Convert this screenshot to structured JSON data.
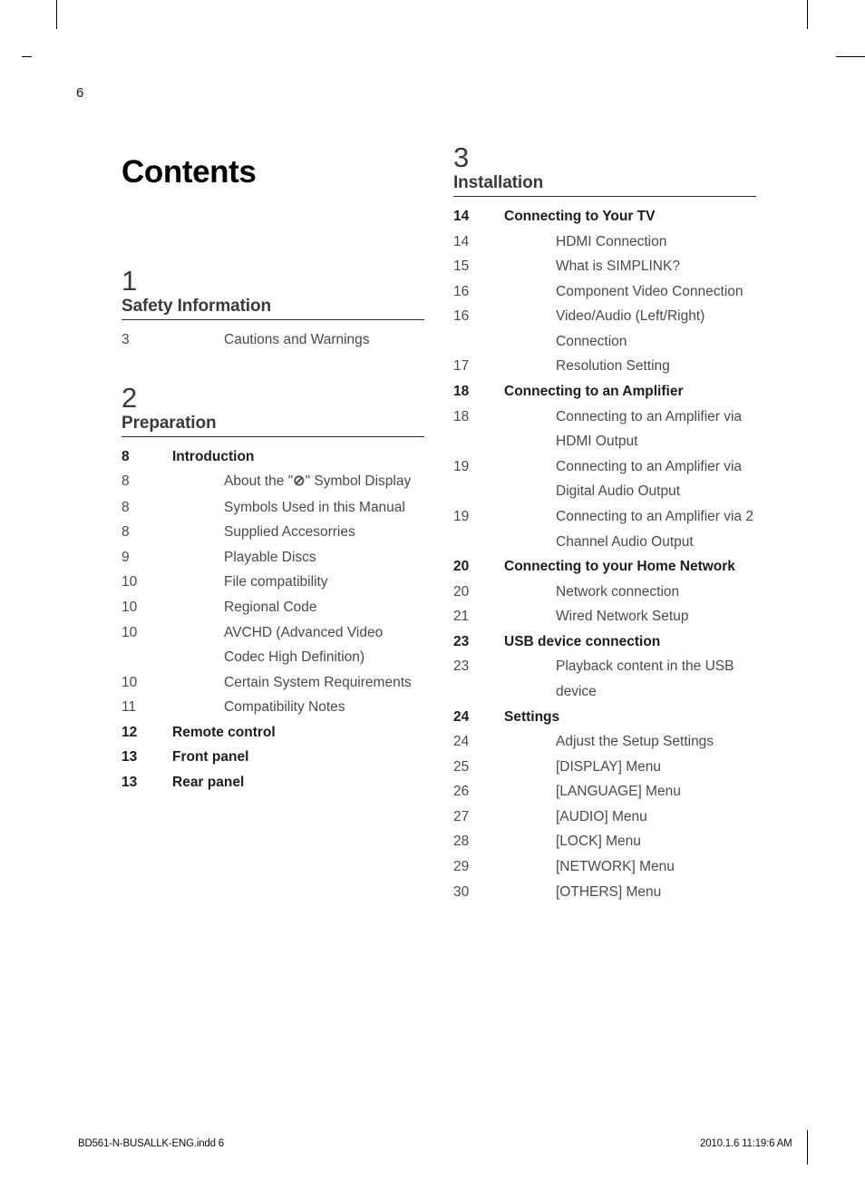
{
  "page": {
    "folio": "6",
    "title": "Contents"
  },
  "footer": {
    "filename": "BD561-N-BUSALLK-ENG.indd   6",
    "timestamp": "2010.1.6   11:19:6 AM"
  },
  "columns": {
    "left": [
      {
        "number": "1",
        "name": "Safety Information",
        "entries": [
          {
            "page": "3",
            "label": "Cautions and Warnings",
            "level": 2
          }
        ]
      },
      {
        "number": "2",
        "name": "Preparation",
        "entries": [
          {
            "page": "8",
            "label": "Introduction",
            "level": 1
          },
          {
            "page": "8",
            "label": "About the \"⊘\" Symbol Display",
            "level": 2,
            "symbol": true
          },
          {
            "page": "8",
            "label": "Symbols Used in this Manual",
            "level": 2
          },
          {
            "page": "8",
            "label": "Supplied Accesorries",
            "level": 2
          },
          {
            "page": "9",
            "label": "Playable Discs",
            "level": 2
          },
          {
            "page": "10",
            "label": "File compatibility",
            "level": 2
          },
          {
            "page": "10",
            "label": "Regional Code",
            "level": 2
          },
          {
            "page": "10",
            "label": "AVCHD (Advanced Video Codec High Definition)",
            "level": 2
          },
          {
            "page": "10",
            "label": "Certain System Requirements",
            "level": 2
          },
          {
            "page": "11",
            "label": "Compatibility Notes",
            "level": 2
          },
          {
            "page": "12",
            "label": "Remote control",
            "level": 1
          },
          {
            "page": "13",
            "label": "Front panel",
            "level": 1
          },
          {
            "page": "13",
            "label": "Rear panel",
            "level": 1
          }
        ]
      }
    ],
    "right": [
      {
        "number": "3",
        "name": "Installation",
        "entries": [
          {
            "page": "14",
            "label": "Connecting to Your TV",
            "level": 1
          },
          {
            "page": "14",
            "label": "HDMI Connection",
            "level": 2
          },
          {
            "page": "15",
            "label": "What is SIMPLINK?",
            "level": 2
          },
          {
            "page": "16",
            "label": "Component Video Connection",
            "level": 2
          },
          {
            "page": "16",
            "label": "Video/Audio (Left/Right) Connection",
            "level": 2
          },
          {
            "page": "17",
            "label": "Resolution Setting",
            "level": 2
          },
          {
            "page": "18",
            "label": "Connecting to an Amplifier",
            "level": 1
          },
          {
            "page": "18",
            "label": "Connecting to an Amplifier via HDMI Output",
            "level": 2
          },
          {
            "page": "19",
            "label": "Connecting to an Amplifier via Digital Audio Output",
            "level": 2
          },
          {
            "page": "19",
            "label": "Connecting to an Amplifier via 2 Channel Audio Output",
            "level": 2
          },
          {
            "page": "20",
            "label": "Connecting to your Home Network",
            "level": 1
          },
          {
            "page": "20",
            "label": "Network connection",
            "level": 2
          },
          {
            "page": "21",
            "label": "Wired Network Setup",
            "level": 2
          },
          {
            "page": "23",
            "label": "USB device connection",
            "level": 1
          },
          {
            "page": "23",
            "label": "Playback content in the USB device",
            "level": 2
          },
          {
            "page": "24",
            "label": "Settings",
            "level": 1
          },
          {
            "page": "24",
            "label": "Adjust the Setup Settings",
            "level": 2
          },
          {
            "page": "25",
            "label": "[DISPLAY] Menu",
            "level": 2
          },
          {
            "page": "26",
            "label": "[LANGUAGE] Menu",
            "level": 2
          },
          {
            "page": "27",
            "label": "[AUDIO] Menu",
            "level": 2
          },
          {
            "page": "28",
            "label": "[LOCK] Menu",
            "level": 2
          },
          {
            "page": "29",
            "label": "[NETWORK] Menu",
            "level": 2
          },
          {
            "page": "30",
            "label": "[OTHERS] Menu",
            "level": 2
          }
        ]
      }
    ]
  }
}
